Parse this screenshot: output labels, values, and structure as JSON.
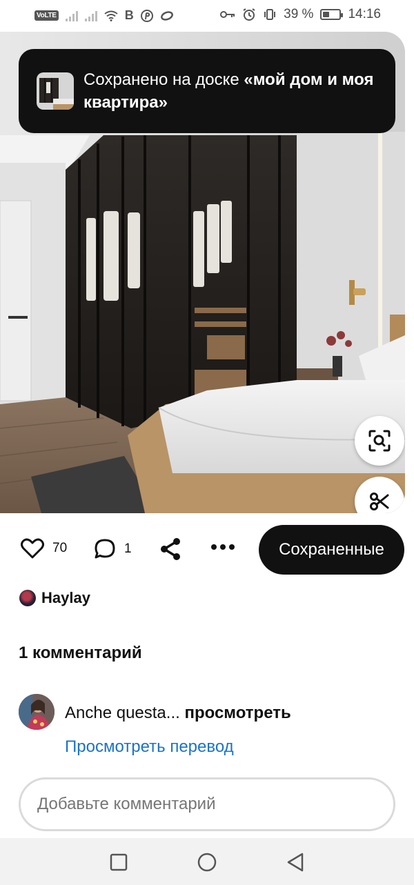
{
  "status_bar": {
    "network_badge": "VoLTE",
    "sim_glyphs": "B",
    "battery_percent": "39 %",
    "battery_level": 0.39,
    "time": "14:16"
  },
  "toast": {
    "prefix": "Сохранено на доске ",
    "board_name": "«мой дом и моя квартира»"
  },
  "actions": {
    "like_count": "70",
    "comment_count": "1",
    "saved_label": "Сохраненные"
  },
  "author": {
    "name": "Haylay"
  },
  "comments": {
    "heading": "1 комментарий",
    "items": [
      {
        "text": "Anche questa...",
        "more_label": "просмотреть",
        "translate_label": "Просмотреть перевод"
      }
    ]
  },
  "comment_input": {
    "placeholder": "Добавьте комментарий"
  },
  "icons": {
    "like": "heart-icon",
    "comment": "speech-bubble-icon",
    "share": "share-icon",
    "more": "ellipsis-icon",
    "visual_search": "lens-icon",
    "cut": "scissors-icon",
    "nav_recent": "square-icon",
    "nav_home": "circle-icon",
    "nav_back": "triangle-back-icon"
  },
  "colors": {
    "dark": "#111111",
    "link": "#1a73c7",
    "nav_bg": "#f2f2f2"
  }
}
